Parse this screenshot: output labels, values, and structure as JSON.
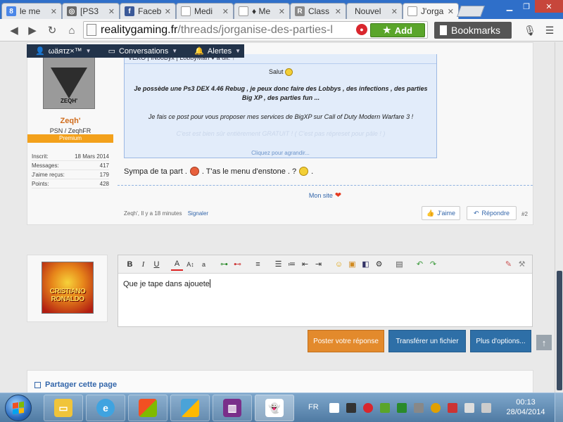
{
  "browser": {
    "tabs": [
      {
        "title": "le me",
        "icon_color": "#4a86e8",
        "icon_glyph": "8"
      },
      {
        "title": "[PS3",
        "icon_color": "#6a6a6a",
        "icon_glyph": "◎"
      },
      {
        "title": "Faceb",
        "icon_color": "#3b5998",
        "icon_glyph": "f"
      },
      {
        "title": "Medi",
        "icon_color": "#bbbbbb",
        "icon_glyph": ""
      },
      {
        "title": "♦ Me",
        "icon_color": "#bbbbbb",
        "icon_glyph": ""
      },
      {
        "title": "Class",
        "icon_color": "#8a8a8a",
        "icon_glyph": "R"
      },
      {
        "title": "Nouvel",
        "icon_color": "#bbbbbb",
        "icon_glyph": ""
      },
      {
        "title": "J'orga",
        "icon_color": "#bbbbbb",
        "icon_glyph": ""
      }
    ],
    "url_host": "realitygaming.fr",
    "url_path": "/threads/jorganise-des-parties-l",
    "add_label": "Add",
    "bookmarks_label": "Bookmarks"
  },
  "site_nav": {
    "user": "ωäяτz×™",
    "conversations": "Conversations",
    "alerts": "Alertes"
  },
  "post": {
    "username": "Zeqh'",
    "user_title": "PSN / ZeqhFR",
    "badge": "Premium",
    "avatar_brand": "ZEQH'",
    "stats": [
      {
        "label": "Inscrit:",
        "value": "18 Mars 2014"
      },
      {
        "label": "Messages:",
        "value": "417"
      },
      {
        "label": "J'aime reçus:",
        "value": "179"
      },
      {
        "label": "Points:",
        "value": "428"
      }
    ],
    "quote_header": "VEKO | iNooByx | LobbyMan ♥ a dit: ↑",
    "quote_salut": "Salut",
    "quote_line1": "Je possède une Ps3 DEX 4.46 Rebug , je peux donc faire des Lobbys , des infections , des parties Big XP , des parties fun ...",
    "quote_line2": "Je fais ce post pour vous proposer mes services de BigXP sur Call of Duty Modern Warfare 3 !",
    "quote_faded": "C'est est bien sûr entièrement GRATUIT ! ( C'est pas répreset pour pâle ! )",
    "quote_expand": "Cliquez pour agrandir...",
    "message_part1": "Sympa de ta part .",
    "message_part2": ". T'as le menu d'enstone . ?",
    "message_part3": ".",
    "signature": "Mon site",
    "meta_author": "Zeqh', Il y a 18 minutes",
    "meta_report": "Signaler",
    "like_label": "J'aime",
    "reply_label": "Répondre",
    "post_number": "#2"
  },
  "reply": {
    "avatar_text_1": "CRISTIANO",
    "avatar_text_2": "RONALDO",
    "editor_text": "Que je tape dans ajouete",
    "toolbar_icons": [
      "bold-icon",
      "italic-icon",
      "underline-icon",
      "text-color-icon",
      "text-size-icon",
      "font-icon",
      "link-icon",
      "unlink-icon",
      "align-icon",
      "bullet-list-icon",
      "numbered-list-icon",
      "outdent-icon",
      "indent-icon",
      "smilie-icon",
      "image-icon",
      "media-icon",
      "settings-icon",
      "save-icon",
      "undo-icon",
      "redo-icon",
      "eraser-icon",
      "toggle-bbcode-icon"
    ],
    "submit_label": "Poster votre réponse",
    "upload_label": "Transférer un fichier",
    "more_label": "Plus d'options...",
    "top_label": "↑"
  },
  "share": {
    "title": "Partager cette page"
  },
  "taskbar": {
    "items": [
      {
        "name": "file-explorer",
        "color": "#f0c43a"
      },
      {
        "name": "internet-explorer",
        "color": "#3fa3e0"
      },
      {
        "name": "windows-live",
        "color": "#e0572a"
      },
      {
        "name": "windows-icon-app",
        "color": "#4aa3d8"
      },
      {
        "name": "winrar",
        "color": "#7a2f8a"
      },
      {
        "name": "ghost-app",
        "color": "#ffffff"
      }
    ],
    "lang": "FR",
    "time": "00:13",
    "date": "28/04/2014"
  },
  "colors": {
    "accent_blue": "#3366aa",
    "premium_orange": "#f3a11b",
    "submit_orange": "#e38a2c",
    "action_blue": "#2e6fa7",
    "nav_dark": "#22334a"
  }
}
